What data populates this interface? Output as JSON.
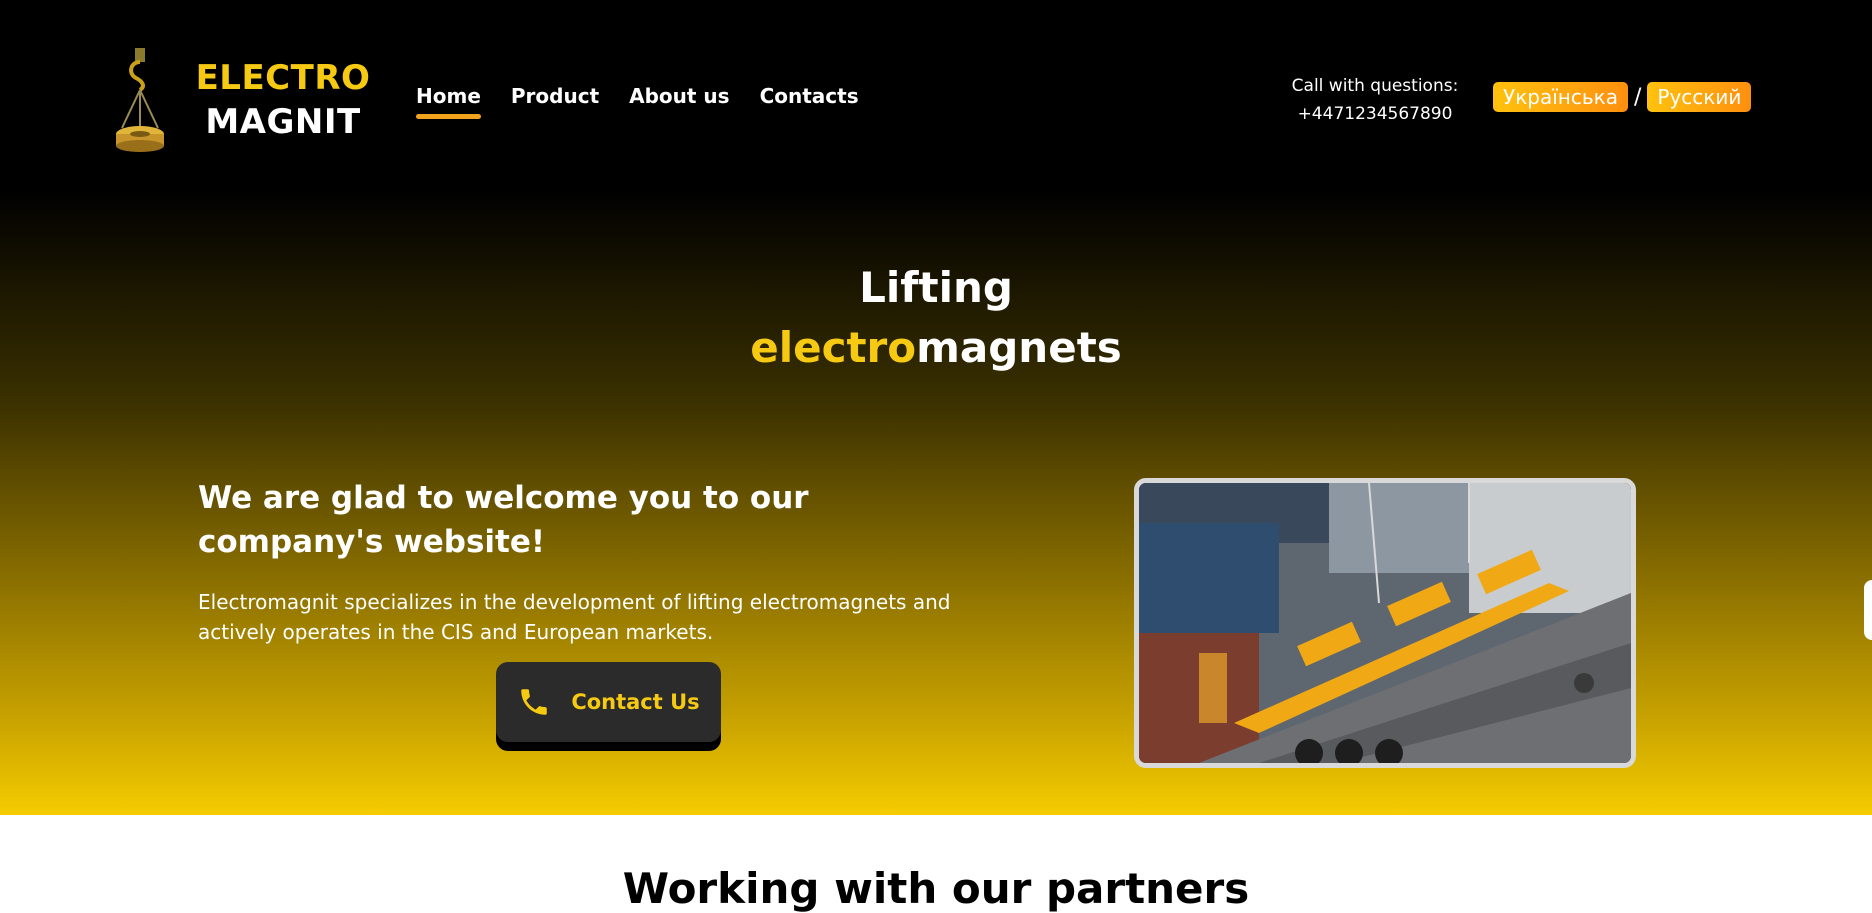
{
  "brand": {
    "line1": "ELECTRO",
    "line2": "MAGNIT"
  },
  "nav": {
    "items": [
      {
        "label": "Home",
        "active": true
      },
      {
        "label": "Product",
        "active": false
      },
      {
        "label": "About us",
        "active": false
      },
      {
        "label": "Contacts",
        "active": false
      }
    ]
  },
  "contact": {
    "call_label": "Call with questions:",
    "phone": "+4471234567890"
  },
  "languages": {
    "items": [
      "Українська",
      "Русский"
    ],
    "separator": "/"
  },
  "hero": {
    "title_line1": "Lifting",
    "title_accent": "electro",
    "title_rest": "magnets",
    "welcome": "We are glad to welcome you to our company's website!",
    "description": "Electromagnit specializes in the development of lifting electromagnets and actively operates in the CIS and European markets.",
    "cta_label": "Contact Us",
    "cta_icon": "phone-icon"
  },
  "next_section": {
    "title": "Working with our partners"
  },
  "colors": {
    "accent_yellow": "#f6c912",
    "accent_orange": "#f2a31c",
    "button_dark": "#2b2b2b",
    "header_bg": "#000000"
  }
}
